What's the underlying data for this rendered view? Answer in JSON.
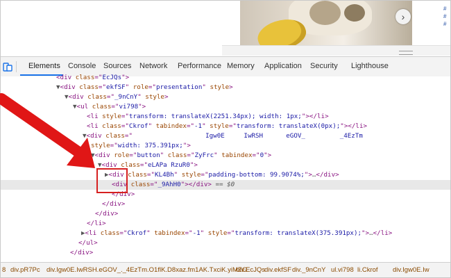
{
  "page": {
    "side_tags": [
      "#",
      "#",
      "#"
    ],
    "next_glyph": "›"
  },
  "devtools": {
    "tabs": [
      "Elements",
      "Console",
      "Sources",
      "Network",
      "Performance",
      "Memory",
      "Application",
      "Security",
      "Lighthouse"
    ],
    "active_tab": "Elements"
  },
  "colors": {
    "tag": "#881280",
    "attr_name": "#994500",
    "attr_value": "#1a1aa6",
    "highlight": "#d62020",
    "tab_underline": "#1a73e8"
  },
  "tree": {
    "l0": {
      "tn": "div",
      "an": "class",
      "av": "EcJQs"
    },
    "l1": {
      "tn": "div",
      "an1": "class",
      "av1": "ekfSF",
      "an2": "role",
      "av2": "presentation",
      "an3": "style"
    },
    "l2": {
      "tn": "div",
      "an1": "class",
      "av1": "_9nCnY",
      "an2": "style"
    },
    "l3": {
      "tn": "ul",
      "an": "class",
      "av": "vi798"
    },
    "l4": {
      "tn": "li",
      "an": "style",
      "av": "transform: translateX(2251.34px); width: 1px;",
      "close": "li"
    },
    "l5": {
      "tn": "li",
      "an1": "class",
      "av1": "Ckrof",
      "an2": "tabindex",
      "av2": "-1",
      "an3": "style",
      "av3": "transform: translateX(0px);",
      "close": "li"
    },
    "l6": {
      "tn": "div",
      "an": "class",
      "av": "                   Igw0E     IwRSH      eGOV_         _4EzTm"
    },
    "l7": {
      "an": "style",
      "av": "width: 375.391px;"
    },
    "l8": {
      "tn": "div",
      "an1": "role",
      "av1": "button",
      "an2": "class",
      "av2": "ZyFrc",
      "an3": "tabindex",
      "av3": "0"
    },
    "l9": {
      "tn": "div",
      "an": "class",
      "av": "eLAPa RzuR0"
    },
    "l10": {
      "tn": "div",
      "an1": "class",
      "av1": "KL4Bh",
      "an2": "style",
      "av2": "padding-bottom: 99.9074%;",
      "close": "div"
    },
    "l11": {
      "tn": "div",
      "an": "class",
      "av": "_9AhH0",
      "close": "div",
      "eq": "== $0"
    },
    "l12": {
      "tn": "div"
    },
    "l13": {
      "tn": "div"
    },
    "l14": {
      "tn": "div"
    },
    "l15": {
      "tn": "li"
    },
    "l16": {
      "tn": "li",
      "an1": "class",
      "av1": "Ckrof",
      "an2": "tabindex",
      "av2": "-1",
      "an3": "style",
      "av3": "transform: translateX(375.391px);",
      "close": "li"
    },
    "l17": {
      "tn": "ul"
    },
    "l18": {
      "tn": "div"
    }
  },
  "breadcrumbs": [
    "8",
    "div.pR7Pc",
    "div.Igw0E.IwRSH.eGOV_._4EzTm.O1flK.D8xaz.fm1AK.TxciK.yiMZG",
    "div.EcJQs",
    "div.ekfSF",
    "div._9nCnY",
    "ul.vi798",
    "li.Ckrof",
    "div.Igw0E.Iw"
  ]
}
